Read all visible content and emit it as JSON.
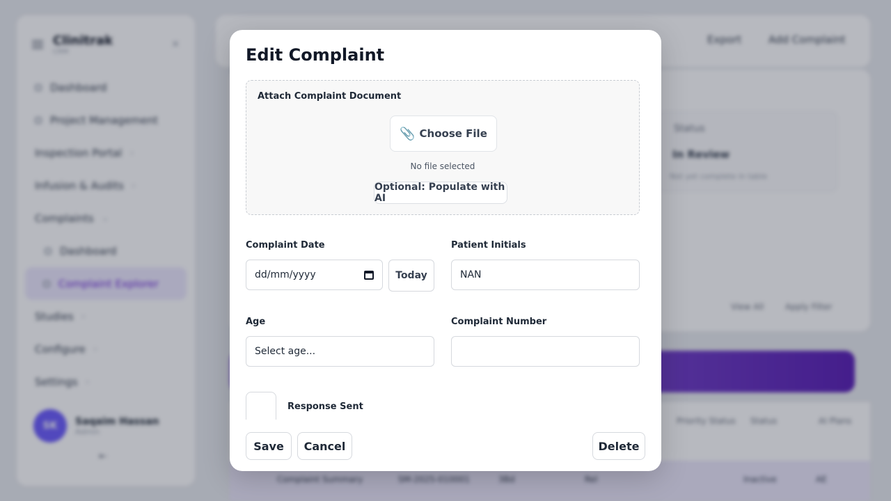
{
  "background": {
    "sidebar": {
      "brand": "Clinitrak",
      "brand_sub": "CRM",
      "items": [
        {
          "label": "Dashboard"
        },
        {
          "label": "Project Management"
        },
        {
          "label": "Inspection Portal"
        },
        {
          "label": "Infusion & Audits"
        },
        {
          "label": "Complaints"
        },
        {
          "label": "Dashboard"
        },
        {
          "label": "Complaint Explorer"
        },
        {
          "label": "Studies"
        },
        {
          "label": "Configure"
        },
        {
          "label": "Settings"
        }
      ],
      "user": {
        "initials": "SK",
        "name": "Saqaim Hassan",
        "role": "Admin"
      },
      "footer_icon": "⇤"
    },
    "top_buttons": {
      "export": "Export",
      "add": "Add Complaint"
    },
    "status_card": {
      "title": "Status",
      "value": "In Review",
      "note": "Not yet complete in table"
    },
    "mini_buttons": {
      "one": "View All",
      "two": "Apply Filter"
    },
    "table_headers": [
      "Priority Status",
      "Status",
      "AI Plans"
    ],
    "table_row": [
      "Complaint Summary",
      "SM-2025-010001",
      "3Bd",
      "Rel",
      "Inactive",
      "AE"
    ]
  },
  "modal": {
    "title": "Edit Complaint",
    "attach": {
      "label": "Attach Complaint Document",
      "choose_file": "Choose File",
      "no_file": "No file selected",
      "ai_button": "Optional: Populate with AI"
    },
    "complaint_date": {
      "label": "Complaint Date",
      "placeholder": "dd/mm/yyyy",
      "today_button": "Today"
    },
    "patient_initials": {
      "label": "Patient Initials",
      "value": "NAN"
    },
    "age": {
      "label": "Age",
      "value": "Select age..."
    },
    "complaint_number": {
      "label": "Complaint Number",
      "value": ""
    },
    "response_sent": {
      "label": "Response Sent",
      "checked": false
    },
    "buttons": {
      "save": "Save",
      "cancel": "Cancel",
      "delete": "Delete"
    }
  }
}
